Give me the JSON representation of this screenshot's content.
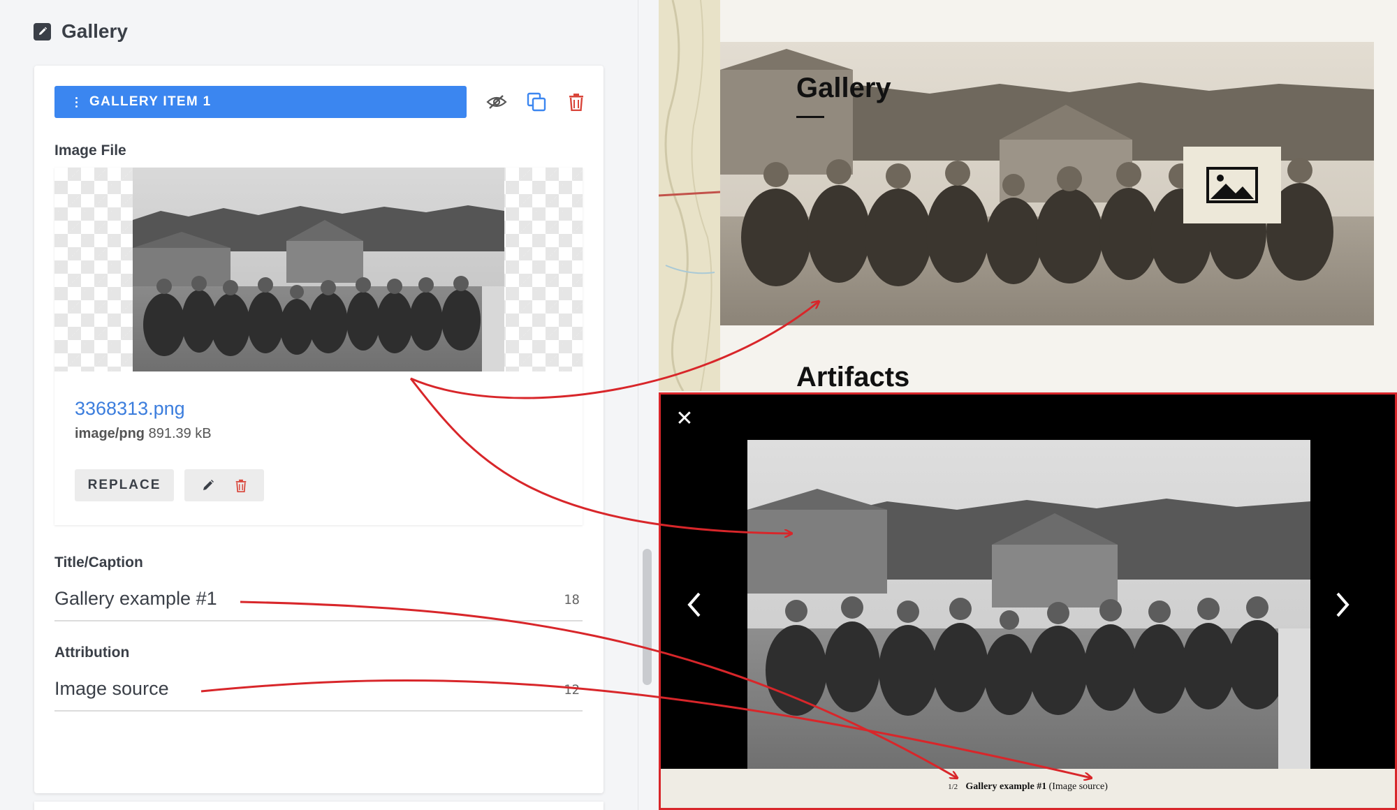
{
  "editor": {
    "section_title": "Gallery",
    "item_bar_label": "GALLERY ITEM 1",
    "image_file_label": "Image File",
    "file": {
      "name": "3368313.png",
      "mime": "image/png",
      "size": "891.39 kB"
    },
    "replace_label": "REPLACE",
    "title_caption": {
      "label": "Title/Caption",
      "value": "Gallery example #1",
      "count": "18"
    },
    "attribution": {
      "label": "Attribution",
      "value": "Image source",
      "count": "12"
    }
  },
  "preview": {
    "hero_title": "Gallery",
    "next_heading": "Artifacts",
    "lightbox": {
      "counter": "1/2",
      "caption_title": "Gallery example #1",
      "caption_attribution": "(Image source)"
    }
  },
  "colors": {
    "accent_blue": "#3b86f0",
    "delete_red": "#d9453a",
    "annotation_red": "#d8262a"
  },
  "icons": [
    "edit-icon",
    "drag-handle-icon",
    "hide-icon",
    "duplicate-icon",
    "delete-icon",
    "pencil-icon",
    "image-placeholder-icon",
    "close-icon",
    "chevron-left-icon",
    "chevron-right-icon"
  ]
}
